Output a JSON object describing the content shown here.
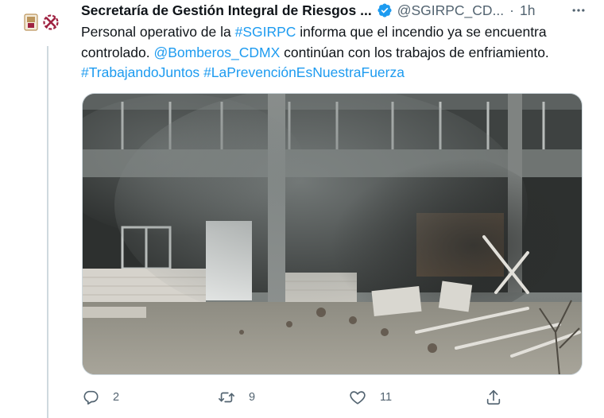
{
  "tweet": {
    "author_name": "Secretaría de Gestión Integral de Riesgos ...",
    "handle": "@SGIRPC_CD...",
    "separator": "·",
    "time": "1h",
    "text": {
      "line1_prefix": "Personal operativo de la ",
      "line1_mention": "#SGIRPC",
      "line1_suffix": " informa que el incendio ya se encuentra",
      "line2_prefix": "controlado. ",
      "line2_mention": "@Bomberos_CDMX",
      "line2_suffix": " continúan con los trabajos de enfriamiento.",
      "hashtag1": "#TrabajandoJuntos",
      "hashtag2": "#LaPrevenciónEsNuestraFuerza"
    }
  },
  "actions": {
    "reply_count": "2",
    "retweet_count": "9",
    "like_count": "11"
  },
  "icons": {
    "verified": "verified-badge-icon",
    "more": "more-icon",
    "reply": "reply-icon",
    "retweet": "retweet-icon",
    "like": "heart-icon",
    "share": "share-icon"
  },
  "colors": {
    "link": "#1d9bf0",
    "secondary_text": "#536471",
    "primary_text": "#0f1419",
    "verified": "#1d9bf0",
    "logo_magenta": "#9f2241",
    "logo_gold": "#bc955c"
  }
}
